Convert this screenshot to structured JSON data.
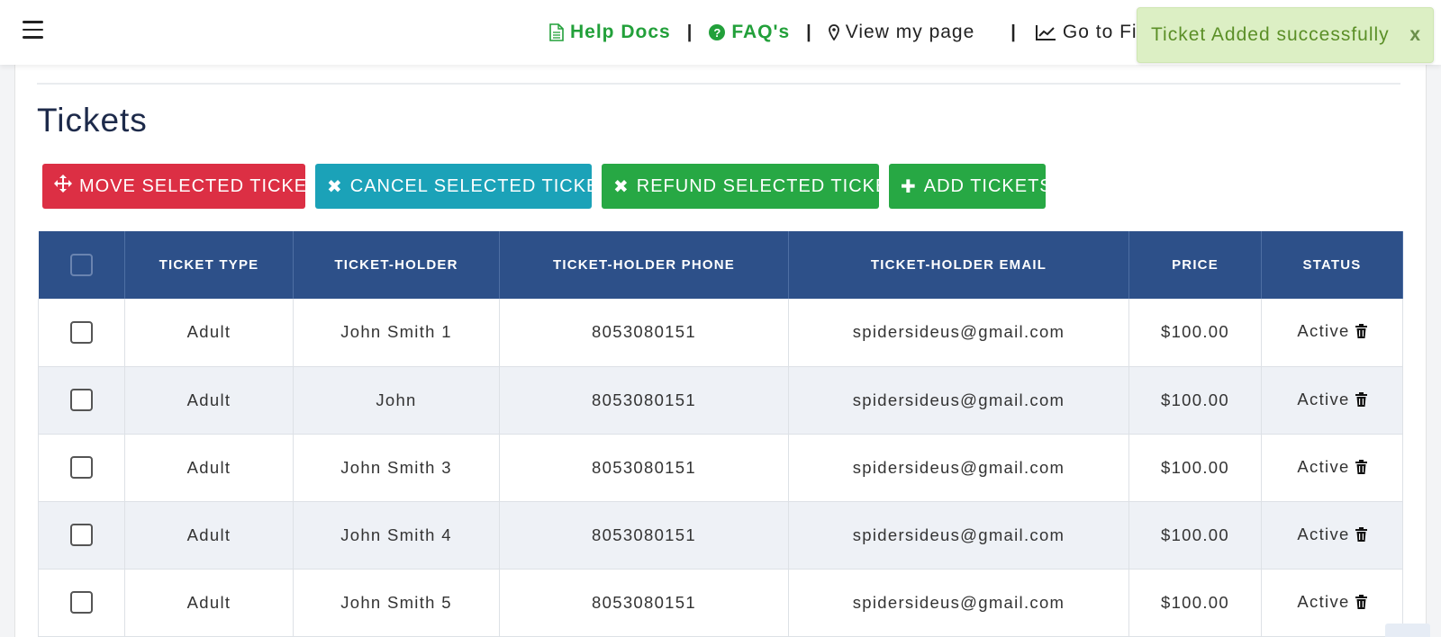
{
  "nav": {
    "help_docs": "Help Docs",
    "faqs": "FAQ's",
    "view_my_page": "View my page",
    "go_to_fis": "Go to Fis"
  },
  "toast": {
    "message": "Ticket Added successfully",
    "close": "x"
  },
  "page": {
    "title": "Tickets"
  },
  "buttons": {
    "move": "MOVE SELECTED TICKETS",
    "cancel": "CANCEL SELECTED TICKETS",
    "refund": "REFUND SELECTED TICKETS",
    "add": "ADD TICKETS"
  },
  "table": {
    "headers": [
      "",
      "TICKET TYPE",
      "TICKET-HOLDER",
      "TICKET-HOLDER PHONE",
      "TICKET-HOLDER EMAIL",
      "PRICE",
      "STATUS"
    ],
    "rows": [
      {
        "type": "Adult",
        "holder": "John Smith 1",
        "phone": "8053080151",
        "email": "spidersideus@gmail.com",
        "price": "$100.00",
        "status": "Active"
      },
      {
        "type": "Adult",
        "holder": "John",
        "phone": "8053080151",
        "email": "spidersideus@gmail.com",
        "price": "$100.00",
        "status": "Active"
      },
      {
        "type": "Adult",
        "holder": "John Smith 3",
        "phone": "8053080151",
        "email": "spidersideus@gmail.com",
        "price": "$100.00",
        "status": "Active"
      },
      {
        "type": "Adult",
        "holder": "John Smith 4",
        "phone": "8053080151",
        "email": "spidersideus@gmail.com",
        "price": "$100.00",
        "status": "Active"
      },
      {
        "type": "Adult",
        "holder": "John Smith 5",
        "phone": "8053080151",
        "email": "spidersideus@gmail.com",
        "price": "$100.00",
        "status": "Active"
      }
    ]
  },
  "colors": {
    "header_blue": "#2d5089",
    "nav_green": "#22a03a",
    "btn_red": "#dc2f44",
    "btn_teal": "#1ba2b8",
    "btn_green": "#27a844",
    "toast_bg": "#dcefc4"
  },
  "icons": {
    "menu": "hamburger-icon",
    "help_docs": "document-icon",
    "faqs": "question-circle-icon",
    "view_my_page": "map-marker-icon",
    "go_to_fis": "line-chart-icon",
    "move": "arrows-move-icon",
    "cancel": "x-icon",
    "refund": "x-icon",
    "add": "plus-icon",
    "status": "trash-icon"
  }
}
